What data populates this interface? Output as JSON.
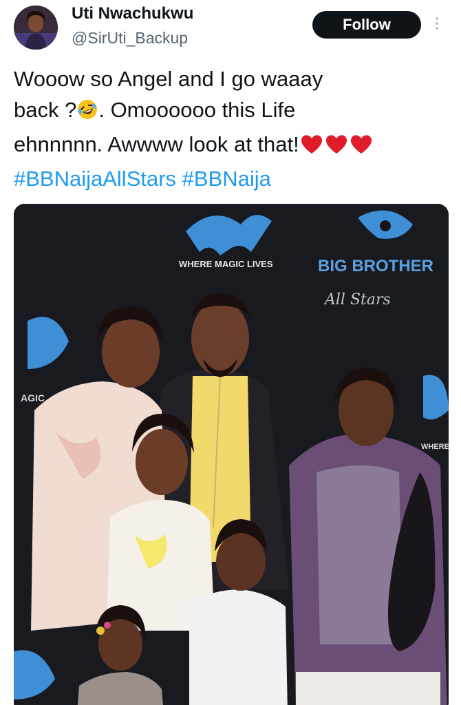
{
  "user": {
    "display_name": "Uti Nwachukwu",
    "handle": "@SirUti_Backup",
    "avatar_icon": "profile-photo"
  },
  "follow_label": "Follow",
  "more_icon": "more-options-icon",
  "tweet": {
    "line1": "Wooow so Angel and I go waaay",
    "line2_a": "back ?",
    "line2_b": ". Omoooooo this Life",
    "line3": "ehnnnnn. Awwww look at that!",
    "hashtags": [
      "#BBNaijaAllStars",
      "#BBNaija"
    ],
    "emoji_laugh": "rolling-on-floor-laughing",
    "emoji_hearts": [
      "red-heart",
      "red-heart",
      "red-heart"
    ]
  },
  "photo": {
    "backdrop_text_where": "WHERE MAGIC LIVES",
    "backdrop_text_brand": "BIG BROTHER",
    "backdrop_text_sub": "All Stars",
    "left_edge_text": "AGIC",
    "right_edge_text": "WHERE M",
    "accent_colors": {
      "logo_blue": "#3f8fd6",
      "backdrop": "#15141a"
    }
  }
}
